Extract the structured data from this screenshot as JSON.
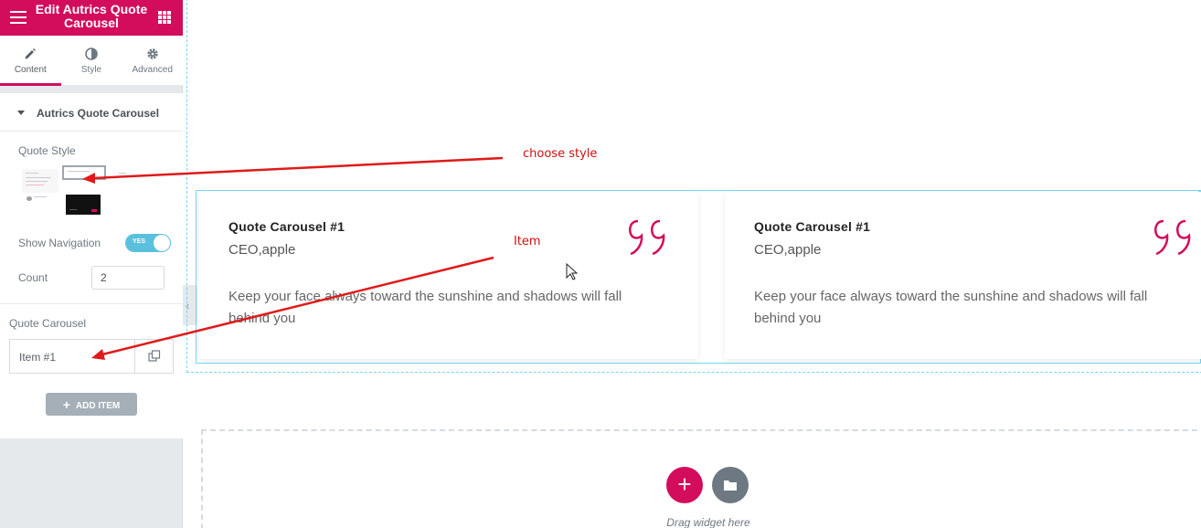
{
  "colors": {
    "brand": "#d30c5c",
    "accent": "#71d7f7",
    "toggle": "#5bc0de",
    "annotation": "#cc1111"
  },
  "sidebar": {
    "header_title": "Edit Autrics Quote Carousel",
    "tabs": [
      {
        "label": "Content",
        "icon": "pencil-icon"
      },
      {
        "label": "Style",
        "icon": "contrast-icon"
      },
      {
        "label": "Advanced",
        "icon": "gear-icon"
      }
    ],
    "section_title": "Autrics Quote Carousel",
    "quote_style_label": "Quote Style",
    "show_navigation_label": "Show Navigation",
    "show_navigation_toggle": "YES",
    "count_label": "Count",
    "count_value": "2",
    "quote_carousel_label": "Quote Carousel",
    "item_title": "Item #1",
    "add_item_label": "ADD ITEM"
  },
  "canvas": {
    "cards": [
      {
        "title": "Quote Carousel #1",
        "role": "CEO,apple",
        "text": "Keep your face always toward the sunshine and shadows will fall behind you"
      },
      {
        "title": "Quote Carousel #1",
        "role": "CEO,apple",
        "text": "Keep your face always toward the sunshine and shadows will fall behind you"
      }
    ],
    "dropzone_text": "Drag widget here"
  },
  "annotations": {
    "choose_style": "choose style",
    "item": "Item"
  }
}
